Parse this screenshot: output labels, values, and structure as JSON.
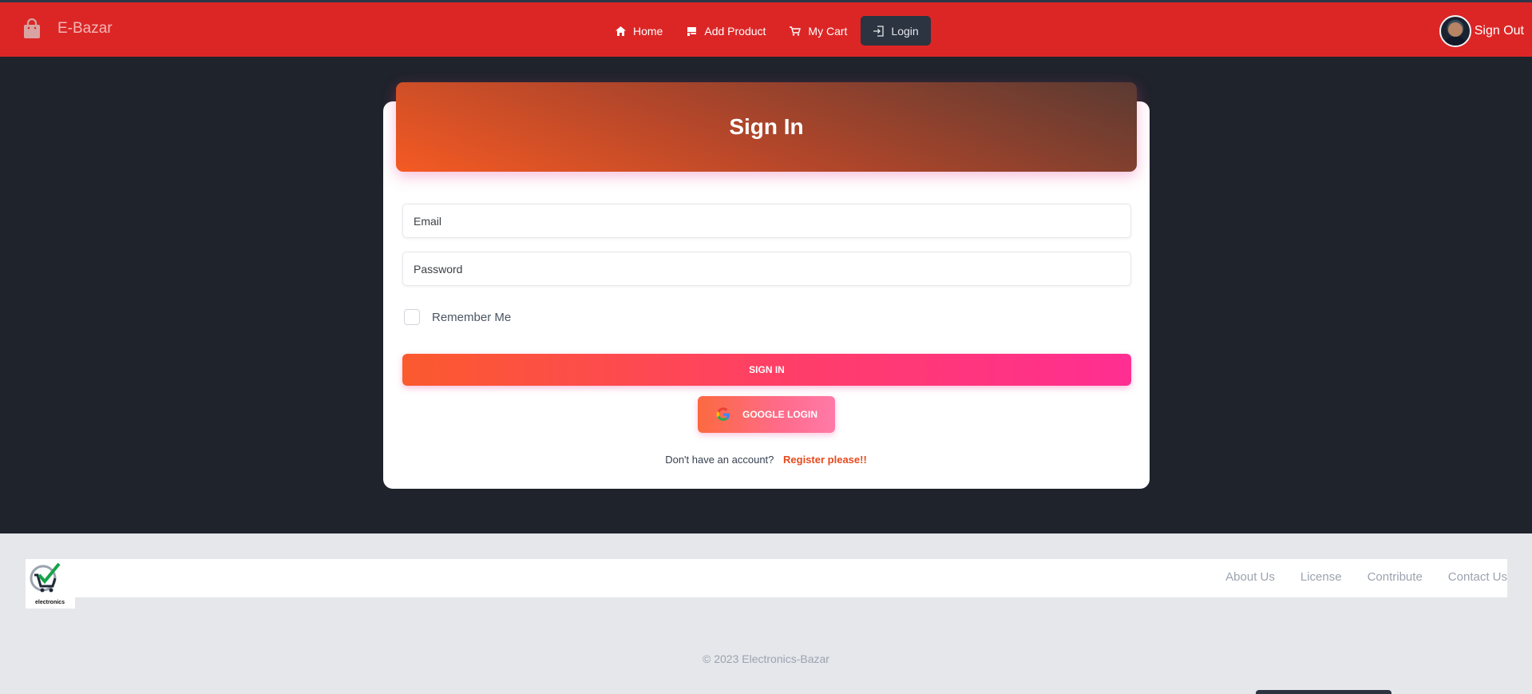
{
  "navbar": {
    "brand": "E-Bazar",
    "links": [
      {
        "label": "Home",
        "icon": "home-icon"
      },
      {
        "label": "Add Product",
        "icon": "product-icon"
      },
      {
        "label": "My Cart",
        "icon": "cart-icon"
      },
      {
        "label": "Login",
        "icon": "login-icon"
      }
    ],
    "sign_out": "Sign Out"
  },
  "form": {
    "title": "Sign In",
    "email_placeholder": "Email",
    "password_placeholder": "Password",
    "remember_label": "Remember Me",
    "signin_label": "SIGN IN",
    "google_label": "GOOGLE LOGIN",
    "register_prompt": "Don't have an account?",
    "register_link": "Register please!!"
  },
  "footer": {
    "logo_text": "electronics",
    "links": [
      "About Us",
      "License",
      "Contribute",
      "Contact Us"
    ],
    "copyright": "© 2023 Electronics-Bazar"
  },
  "colors": {
    "navbar": "#dc2626",
    "page_background": "#1f232b",
    "accent": "#e8491d",
    "footer_background": "#e5e7eb"
  }
}
